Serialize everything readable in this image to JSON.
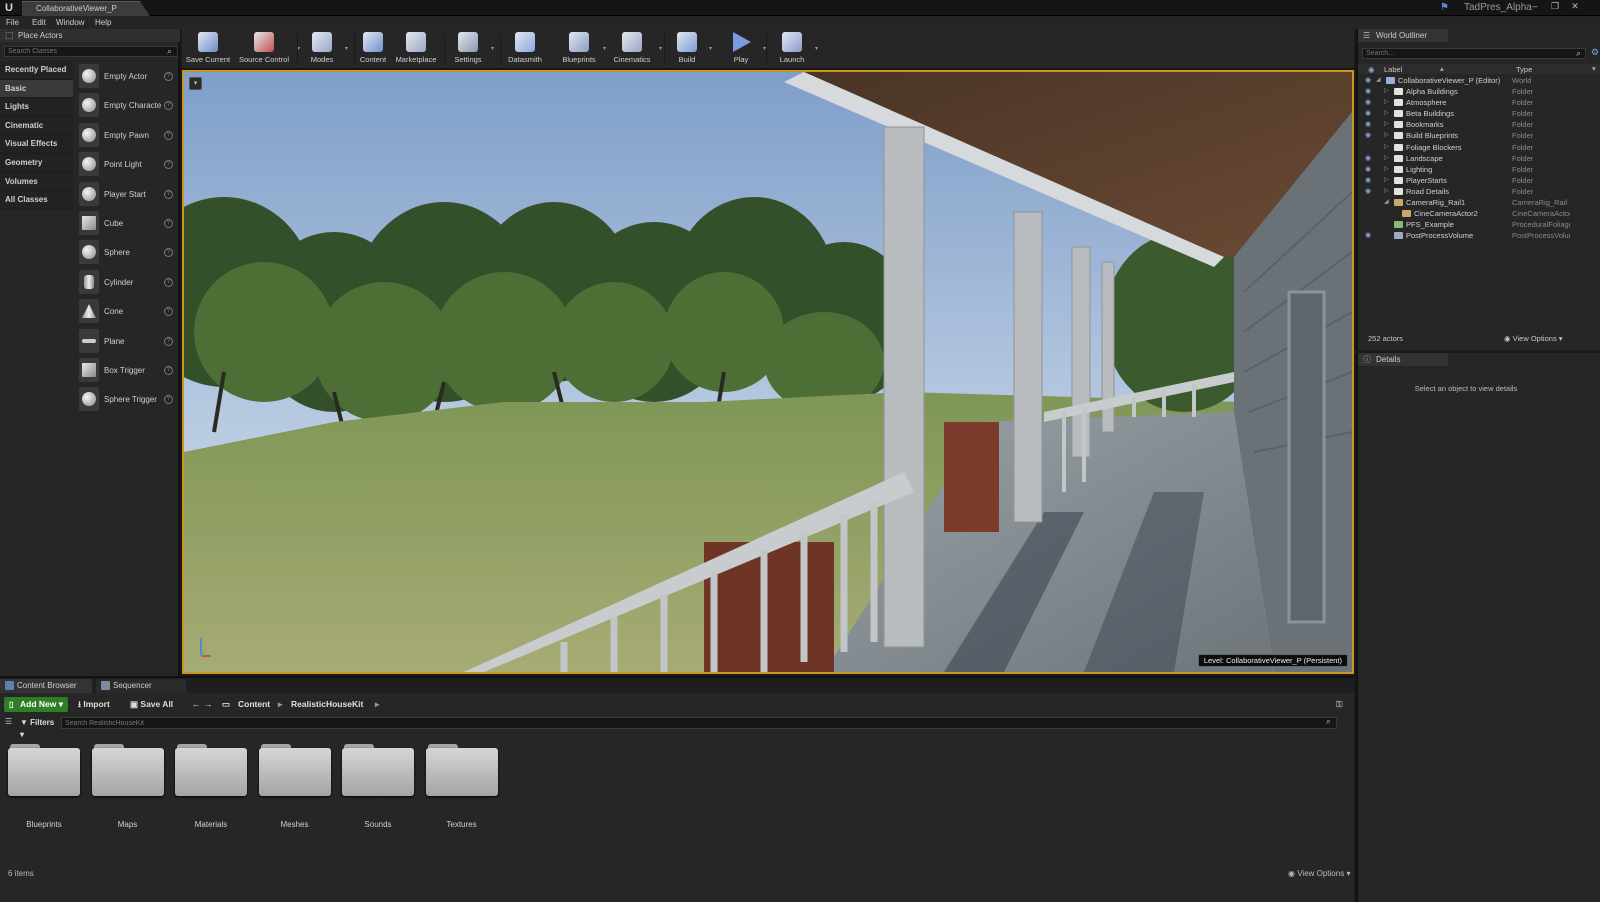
{
  "titlebar": {
    "doc_tab": "CollaborativeViewer_P",
    "project_name": "TadPres_Alpha",
    "window_buttons": [
      "–",
      "❐",
      "✕"
    ]
  },
  "menu": [
    "File",
    "Edit",
    "Window",
    "Help"
  ],
  "place_actors": {
    "tab_label": "Place Actors",
    "search_placeholder": "Search Classes",
    "categories": [
      "Recently Placed",
      "Basic",
      "Lights",
      "Cinematic",
      "Visual Effects",
      "Geometry",
      "Volumes",
      "All Classes"
    ],
    "selected_category": "Basic",
    "items": [
      {
        "label": "Empty Actor",
        "icon": "sphere-icon"
      },
      {
        "label": "Empty Characte",
        "icon": "character-icon"
      },
      {
        "label": "Empty Pawn",
        "icon": "pawn-icon"
      },
      {
        "label": "Point Light",
        "icon": "light-bulb-icon"
      },
      {
        "label": "Player Start",
        "icon": "player-start-icon"
      },
      {
        "label": "Cube",
        "icon": "cube-icon"
      },
      {
        "label": "Sphere",
        "icon": "sphere-icon"
      },
      {
        "label": "Cylinder",
        "icon": "cylinder-icon"
      },
      {
        "label": "Cone",
        "icon": "cone-icon"
      },
      {
        "label": "Plane",
        "icon": "plane-icon"
      },
      {
        "label": "Box Trigger",
        "icon": "box-trigger-icon"
      },
      {
        "label": "Sphere Trigger",
        "icon": "sphere-trigger-icon"
      }
    ]
  },
  "toolbar": {
    "buttons": [
      {
        "label": "Save Current",
        "icon": "save-icon",
        "color": "#6d8ccc"
      },
      {
        "label": "Source Control",
        "icon": "source-control-icon",
        "color": "#c05050"
      },
      {
        "label": "Modes",
        "icon": "modes-icon",
        "color": "#9aa6c8"
      },
      {
        "label": "Content",
        "icon": "content-icon",
        "color": "#7090d0"
      },
      {
        "label": "Marketplace",
        "icon": "marketplace-icon",
        "color": "#9aa8c0"
      },
      {
        "label": "Settings",
        "icon": "settings-icon",
        "color": "#8a96b0"
      },
      {
        "label": "Datasmith",
        "icon": "datasmith-icon",
        "color": "#8aa6e0"
      },
      {
        "label": "Blueprints",
        "icon": "blueprints-icon",
        "color": "#8a9cc0"
      },
      {
        "label": "Cinematics",
        "icon": "cinematics-icon",
        "color": "#9aa6c0"
      },
      {
        "label": "Build",
        "icon": "build-icon",
        "color": "#7a9ad8"
      },
      {
        "label": "Play",
        "icon": "play-icon",
        "color": "#7a9ae0"
      },
      {
        "label": "Launch",
        "icon": "launch-icon",
        "color": "#8a9ad0"
      }
    ]
  },
  "viewport": {
    "level_label": "Level:  CollaborativeViewer_P (Persistent)",
    "accent": "#c8961a"
  },
  "content_browser": {
    "tabs": [
      "Content Browser",
      "Sequencer"
    ],
    "add_new": "Add New",
    "import": "Import",
    "save_all": "Save All",
    "breadcrumb": [
      "Content",
      "RealisticHouseKit"
    ],
    "filters": "Filters",
    "search_placeholder": "Search RealisticHouseKit",
    "folders": [
      "Blueprints",
      "Maps",
      "Materials",
      "Meshes",
      "Sounds",
      "Textures"
    ],
    "item_count": "6 items",
    "view_options": "View Options"
  },
  "outliner": {
    "tab_label": "World Outliner",
    "search_placeholder": "Search...",
    "columns": [
      "Label",
      "Type"
    ],
    "rows": [
      {
        "label": "CollaborativeViewer_P (Editor)",
        "type": "World",
        "depth": 0,
        "expanded": true,
        "eye": true,
        "icon": "world-icon"
      },
      {
        "label": "Alpha Buildings",
        "type": "Folder",
        "depth": 1,
        "eye": true,
        "icon": "folder-icon"
      },
      {
        "label": "Atmosphere",
        "type": "Folder",
        "depth": 1,
        "eye": true,
        "icon": "folder-icon"
      },
      {
        "label": "Beta Buildings",
        "type": "Folder",
        "depth": 1,
        "eye": true,
        "icon": "folder-icon"
      },
      {
        "label": "Bookmarks",
        "type": "Folder",
        "depth": 1,
        "eye": true,
        "icon": "folder-icon"
      },
      {
        "label": "Build Blueprints",
        "type": "Folder",
        "depth": 1,
        "eye": true,
        "icon": "folder-icon"
      },
      {
        "label": "Foliage Blockers",
        "type": "Folder",
        "depth": 1,
        "eye": false,
        "icon": "folder-icon"
      },
      {
        "label": "Landscape",
        "type": "Folder",
        "depth": 1,
        "eye": true,
        "icon": "folder-icon"
      },
      {
        "label": "Lighting",
        "type": "Folder",
        "depth": 1,
        "eye": true,
        "icon": "folder-icon"
      },
      {
        "label": "PlayerStarts",
        "type": "Folder",
        "depth": 1,
        "eye": true,
        "icon": "folder-icon"
      },
      {
        "label": "Road Details",
        "type": "Folder",
        "depth": 1,
        "eye": true,
        "icon": "folder-icon"
      },
      {
        "label": "CameraRig_Rail1",
        "type": "CameraRig_Rail",
        "depth": 1,
        "expanded": true,
        "eye": false,
        "icon": "camera-rig-icon"
      },
      {
        "label": "CineCameraActor2",
        "type": "CineCameraActor",
        "depth": 2,
        "eye": false,
        "icon": "camera-icon"
      },
      {
        "label": "PFS_Example",
        "type": "ProceduralFoliage",
        "depth": 1,
        "eye": false,
        "icon": "foliage-icon"
      },
      {
        "label": "PostProcessVolume",
        "type": "PostProcessVolume",
        "depth": 1,
        "eye": true,
        "icon": "volume-icon"
      }
    ],
    "actor_count": "252 actors",
    "view_options": "View Options"
  },
  "details": {
    "tab_label": "Details",
    "empty_message": "Select an object to view details"
  }
}
